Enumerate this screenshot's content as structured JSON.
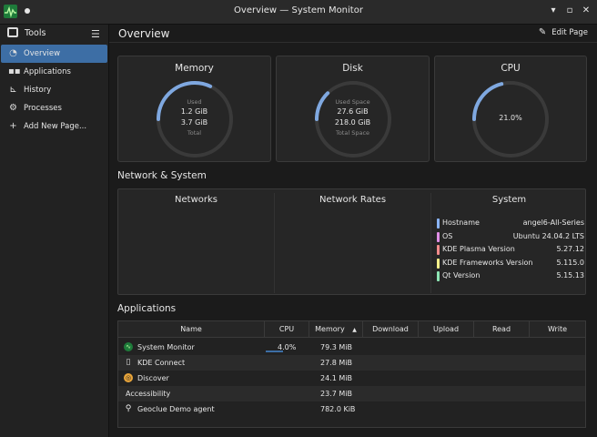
{
  "window": {
    "title": "Overview — System Monitor",
    "controls": [
      "▾",
      "▫",
      "✕"
    ]
  },
  "sidebar": {
    "header": {
      "label": "Tools",
      "menu_icon": "hamburger-menu-icon"
    },
    "items": [
      {
        "label": "Overview",
        "icon": "gauge-icon",
        "active": true
      },
      {
        "label": "Applications",
        "icon": "grid-icon",
        "active": false
      },
      {
        "label": "History",
        "icon": "chart-icon",
        "active": false
      },
      {
        "label": "Processes",
        "icon": "processes-icon",
        "active": false
      },
      {
        "label": "Add New Page...",
        "icon": "plus-icon",
        "active": false
      }
    ]
  },
  "header": {
    "title": "Overview",
    "edit_label": "Edit Page"
  },
  "cards": {
    "memory": {
      "title": "Memory",
      "used_label": "Used",
      "used": "1.2 GiB",
      "total": "3.7 GiB",
      "total_label": "Total",
      "fraction": 0.32
    },
    "disk": {
      "title": "Disk",
      "used_label": "Used Space",
      "used": "27.6 GiB",
      "total": "218.0 GiB",
      "total_label": "Total Space",
      "fraction": 0.127
    },
    "cpu": {
      "title": "CPU",
      "value": "21.0%",
      "fraction": 0.21
    }
  },
  "network_section": {
    "title": "Network & System",
    "columns": {
      "networks": "Networks",
      "rates": "Network Rates",
      "system": "System"
    },
    "system_info": [
      {
        "key": "Hostname",
        "value": "angel6-All-Series",
        "color": "#8ab4f8"
      },
      {
        "key": "OS",
        "value": "Ubuntu 24.04.2 LTS",
        "color": "#e08ee6"
      },
      {
        "key": "KDE Plasma Version",
        "value": "5.27.12",
        "color": "#f28b8b"
      },
      {
        "key": "KDE Frameworks Version",
        "value": "5.115.0",
        "color": "#f5f08a"
      },
      {
        "key": "Qt Version",
        "value": "5.15.13",
        "color": "#8ee6b4"
      }
    ]
  },
  "applications": {
    "title": "Applications",
    "columns": [
      "Name",
      "CPU",
      "Memory",
      "Download",
      "Upload",
      "Read",
      "Write"
    ],
    "sort_indicator": "▲",
    "rows": [
      {
        "name": "System Monitor",
        "cpu": "4.0%",
        "memory": "79.3 MiB",
        "icon": "system-monitor-icon",
        "cpu_fraction": 0.04
      },
      {
        "name": "KDE Connect",
        "cpu": "",
        "memory": "27.8 MiB",
        "icon": "kde-connect-icon"
      },
      {
        "name": "Discover",
        "cpu": "",
        "memory": "24.1 MiB",
        "icon": "discover-icon"
      },
      {
        "name": "Accessibility",
        "cpu": "",
        "memory": "23.7 MiB",
        "icon": ""
      },
      {
        "name": "Geoclue Demo agent",
        "cpu": "",
        "memory": "782.0 KiB",
        "icon": "location-pin-icon"
      }
    ]
  },
  "colors": {
    "accent": "#3d6ea5",
    "gauge": "#7fa8e0",
    "track": "#3a3a3a"
  }
}
